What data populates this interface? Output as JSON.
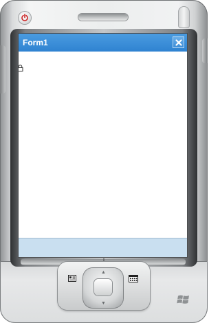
{
  "window": {
    "title": "Form1"
  },
  "icons": {
    "power": "power-icon",
    "close": "close-icon",
    "lock": "lock-icon",
    "contacts": "contacts-icon",
    "calendar": "calendar-icon",
    "windows": "windows-logo-icon"
  },
  "colors": {
    "title_bar": "#2f83d1",
    "menu_bar": "#c9dff0",
    "power_accent": "#cc2b2b"
  }
}
